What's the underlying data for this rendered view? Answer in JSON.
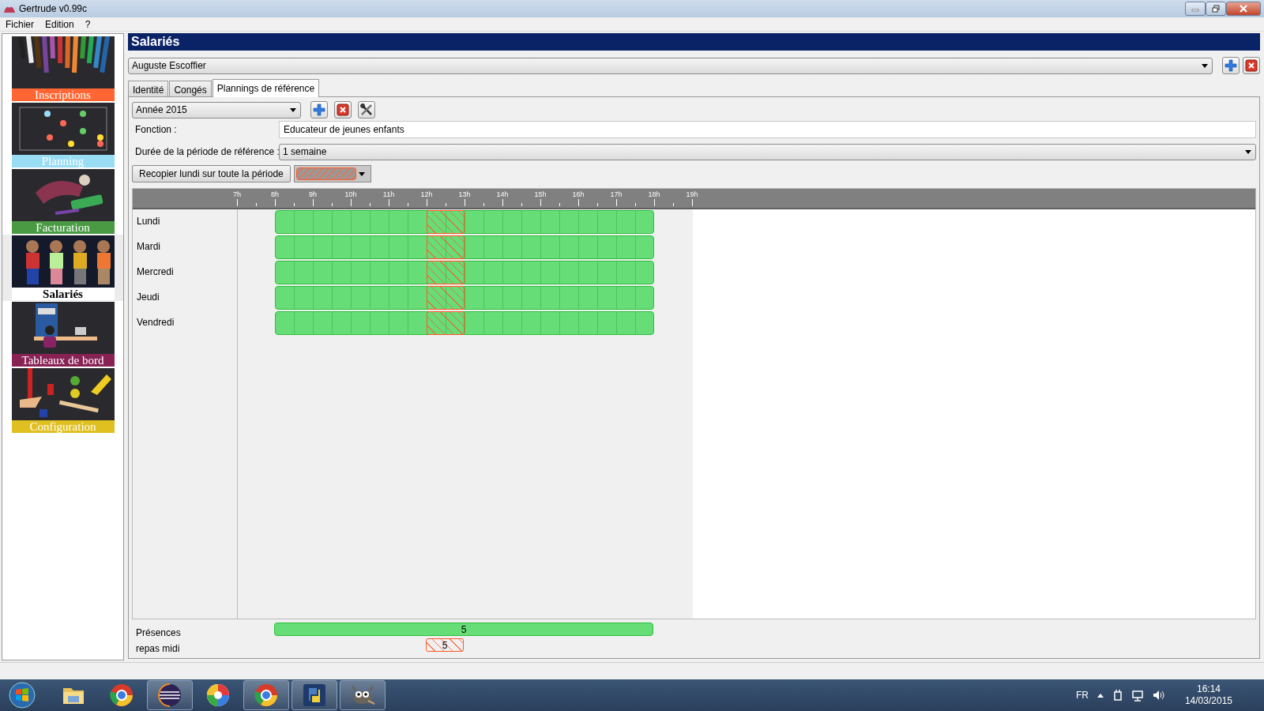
{
  "window": {
    "title": "Gertrude v0.99c"
  },
  "menu": [
    "Fichier",
    "Edition",
    "?"
  ],
  "sidebar": {
    "items": [
      {
        "label": "Inscriptions",
        "color": "#ff6633",
        "selected": false
      },
      {
        "label": "Planning",
        "color": "#99ddf5",
        "selected": false
      },
      {
        "label": "Facturation",
        "color": "#4a9a44",
        "selected": false
      },
      {
        "label": "Salariés",
        "color": "#ffffff",
        "selected": true
      },
      {
        "label": "Tableaux de bord",
        "color": "#882255",
        "selected": false
      },
      {
        "label": "Configuration",
        "color": "#e0c020",
        "selected": false
      }
    ]
  },
  "page": {
    "title": "Salariés"
  },
  "employee": {
    "value": "Auguste Escoffier"
  },
  "tabs": [
    {
      "label": "Identité",
      "selected": false
    },
    {
      "label": "Congés",
      "selected": false
    },
    {
      "label": "Plannings de référence",
      "selected": true
    }
  ],
  "period": {
    "value": "Année 2015"
  },
  "fields": [
    {
      "kind": "text",
      "label": "Fonction :",
      "value": "Educateur de jeunes enfants"
    },
    {
      "kind": "select",
      "label": "Durée de la période de référence :",
      "value": "1 semaine"
    }
  ],
  "copy_button": "Recopier lundi sur toute la période",
  "activity_picker": {
    "kind": "repas"
  },
  "timeline": {
    "hours": [
      "7h",
      "8h",
      "9h",
      "10h",
      "11h",
      "12h",
      "13h",
      "14h",
      "15h",
      "16h",
      "17h",
      "18h",
      "19h"
    ],
    "days": [
      {
        "label": "Lundi",
        "half_hours": [
          {
            "kind": "none"
          },
          {
            "kind": "none"
          },
          {
            "kind": "presence"
          },
          {
            "kind": "presence"
          },
          {
            "kind": "presence"
          },
          {
            "kind": "presence"
          },
          {
            "kind": "presence"
          },
          {
            "kind": "presence"
          },
          {
            "kind": "presence"
          },
          {
            "kind": "presence"
          },
          {
            "kind": "repas"
          },
          {
            "kind": "repas"
          },
          {
            "kind": "presence"
          },
          {
            "kind": "presence"
          },
          {
            "kind": "presence"
          },
          {
            "kind": "presence"
          },
          {
            "kind": "presence"
          },
          {
            "kind": "presence"
          },
          {
            "kind": "presence"
          },
          {
            "kind": "presence"
          },
          {
            "kind": "presence"
          },
          {
            "kind": "presence"
          },
          {
            "kind": "none"
          },
          {
            "kind": "none"
          }
        ]
      },
      {
        "label": "Mardi",
        "half_hours": [
          {
            "kind": "none"
          },
          {
            "kind": "none"
          },
          {
            "kind": "presence"
          },
          {
            "kind": "presence"
          },
          {
            "kind": "presence"
          },
          {
            "kind": "presence"
          },
          {
            "kind": "presence"
          },
          {
            "kind": "presence"
          },
          {
            "kind": "presence"
          },
          {
            "kind": "presence"
          },
          {
            "kind": "repas"
          },
          {
            "kind": "repas"
          },
          {
            "kind": "presence"
          },
          {
            "kind": "presence"
          },
          {
            "kind": "presence"
          },
          {
            "kind": "presence"
          },
          {
            "kind": "presence"
          },
          {
            "kind": "presence"
          },
          {
            "kind": "presence"
          },
          {
            "kind": "presence"
          },
          {
            "kind": "presence"
          },
          {
            "kind": "presence"
          },
          {
            "kind": "none"
          },
          {
            "kind": "none"
          }
        ]
      },
      {
        "label": "Mercredi",
        "half_hours": [
          {
            "kind": "none"
          },
          {
            "kind": "none"
          },
          {
            "kind": "presence"
          },
          {
            "kind": "presence"
          },
          {
            "kind": "presence"
          },
          {
            "kind": "presence"
          },
          {
            "kind": "presence"
          },
          {
            "kind": "presence"
          },
          {
            "kind": "presence"
          },
          {
            "kind": "presence"
          },
          {
            "kind": "repas"
          },
          {
            "kind": "repas"
          },
          {
            "kind": "presence"
          },
          {
            "kind": "presence"
          },
          {
            "kind": "presence"
          },
          {
            "kind": "presence"
          },
          {
            "kind": "presence"
          },
          {
            "kind": "presence"
          },
          {
            "kind": "presence"
          },
          {
            "kind": "presence"
          },
          {
            "kind": "presence"
          },
          {
            "kind": "presence"
          },
          {
            "kind": "none"
          },
          {
            "kind": "none"
          }
        ]
      },
      {
        "label": "Jeudi",
        "half_hours": [
          {
            "kind": "none"
          },
          {
            "kind": "none"
          },
          {
            "kind": "presence"
          },
          {
            "kind": "presence"
          },
          {
            "kind": "presence"
          },
          {
            "kind": "presence"
          },
          {
            "kind": "presence"
          },
          {
            "kind": "presence"
          },
          {
            "kind": "presence"
          },
          {
            "kind": "presence"
          },
          {
            "kind": "repas"
          },
          {
            "kind": "repas"
          },
          {
            "kind": "presence"
          },
          {
            "kind": "presence"
          },
          {
            "kind": "presence"
          },
          {
            "kind": "presence"
          },
          {
            "kind": "presence"
          },
          {
            "kind": "presence"
          },
          {
            "kind": "presence"
          },
          {
            "kind": "presence"
          },
          {
            "kind": "presence"
          },
          {
            "kind": "presence"
          },
          {
            "kind": "none"
          },
          {
            "kind": "none"
          }
        ]
      },
      {
        "label": "Vendredi",
        "half_hours": [
          {
            "kind": "none"
          },
          {
            "kind": "none"
          },
          {
            "kind": "presence"
          },
          {
            "kind": "presence"
          },
          {
            "kind": "presence"
          },
          {
            "kind": "presence"
          },
          {
            "kind": "presence"
          },
          {
            "kind": "presence"
          },
          {
            "kind": "presence"
          },
          {
            "kind": "presence"
          },
          {
            "kind": "repas"
          },
          {
            "kind": "repas"
          },
          {
            "kind": "presence"
          },
          {
            "kind": "presence"
          },
          {
            "kind": "presence"
          },
          {
            "kind": "presence"
          },
          {
            "kind": "presence"
          },
          {
            "kind": "presence"
          },
          {
            "kind": "presence"
          },
          {
            "kind": "presence"
          },
          {
            "kind": "presence"
          },
          {
            "kind": "presence"
          },
          {
            "kind": "none"
          },
          {
            "kind": "none"
          }
        ]
      }
    ]
  },
  "totals": [
    {
      "label": "Présences",
      "kind": "presence",
      "count": "5",
      "half_hours": [
        {
          "kind": "none"
        },
        {
          "kind": "none"
        },
        {
          "kind": "presence"
        },
        {
          "kind": "presence"
        },
        {
          "kind": "presence"
        },
        {
          "kind": "presence"
        },
        {
          "kind": "presence"
        },
        {
          "kind": "presence"
        },
        {
          "kind": "presence"
        },
        {
          "kind": "presence"
        },
        {
          "kind": "presence"
        },
        {
          "kind": "presence"
        },
        {
          "kind": "presence"
        },
        {
          "kind": "presence"
        },
        {
          "kind": "presence"
        },
        {
          "kind": "presence"
        },
        {
          "kind": "presence"
        },
        {
          "kind": "presence"
        },
        {
          "kind": "presence"
        },
        {
          "kind": "presence"
        },
        {
          "kind": "presence"
        },
        {
          "kind": "presence"
        },
        {
          "kind": "none"
        },
        {
          "kind": "none"
        }
      ]
    },
    {
      "label": "repas midi",
      "kind": "repas",
      "count": "5",
      "half_hours": [
        {
          "kind": "none"
        },
        {
          "kind": "none"
        },
        {
          "kind": "none"
        },
        {
          "kind": "none"
        },
        {
          "kind": "none"
        },
        {
          "kind": "none"
        },
        {
          "kind": "none"
        },
        {
          "kind": "none"
        },
        {
          "kind": "none"
        },
        {
          "kind": "none"
        },
        {
          "kind": "repas"
        },
        {
          "kind": "repas"
        },
        {
          "kind": "none"
        },
        {
          "kind": "none"
        },
        {
          "kind": "none"
        },
        {
          "kind": "none"
        },
        {
          "kind": "none"
        },
        {
          "kind": "none"
        },
        {
          "kind": "none"
        },
        {
          "kind": "none"
        },
        {
          "kind": "none"
        },
        {
          "kind": "none"
        },
        {
          "kind": "none"
        },
        {
          "kind": "none"
        }
      ]
    }
  ],
  "taskbar": {
    "apps": [
      {
        "kind": "folder",
        "active": false
      },
      {
        "kind": "browser",
        "active": false
      },
      {
        "kind": "eclipse",
        "active": true
      },
      {
        "kind": "pinwheel",
        "active": false
      },
      {
        "kind": "browser",
        "active": true
      },
      {
        "kind": "python",
        "active": true
      },
      {
        "kind": "gimp",
        "active": true
      }
    ]
  },
  "tray": {
    "language": "FR",
    "time": "16:14",
    "date": "14/03/2015"
  }
}
